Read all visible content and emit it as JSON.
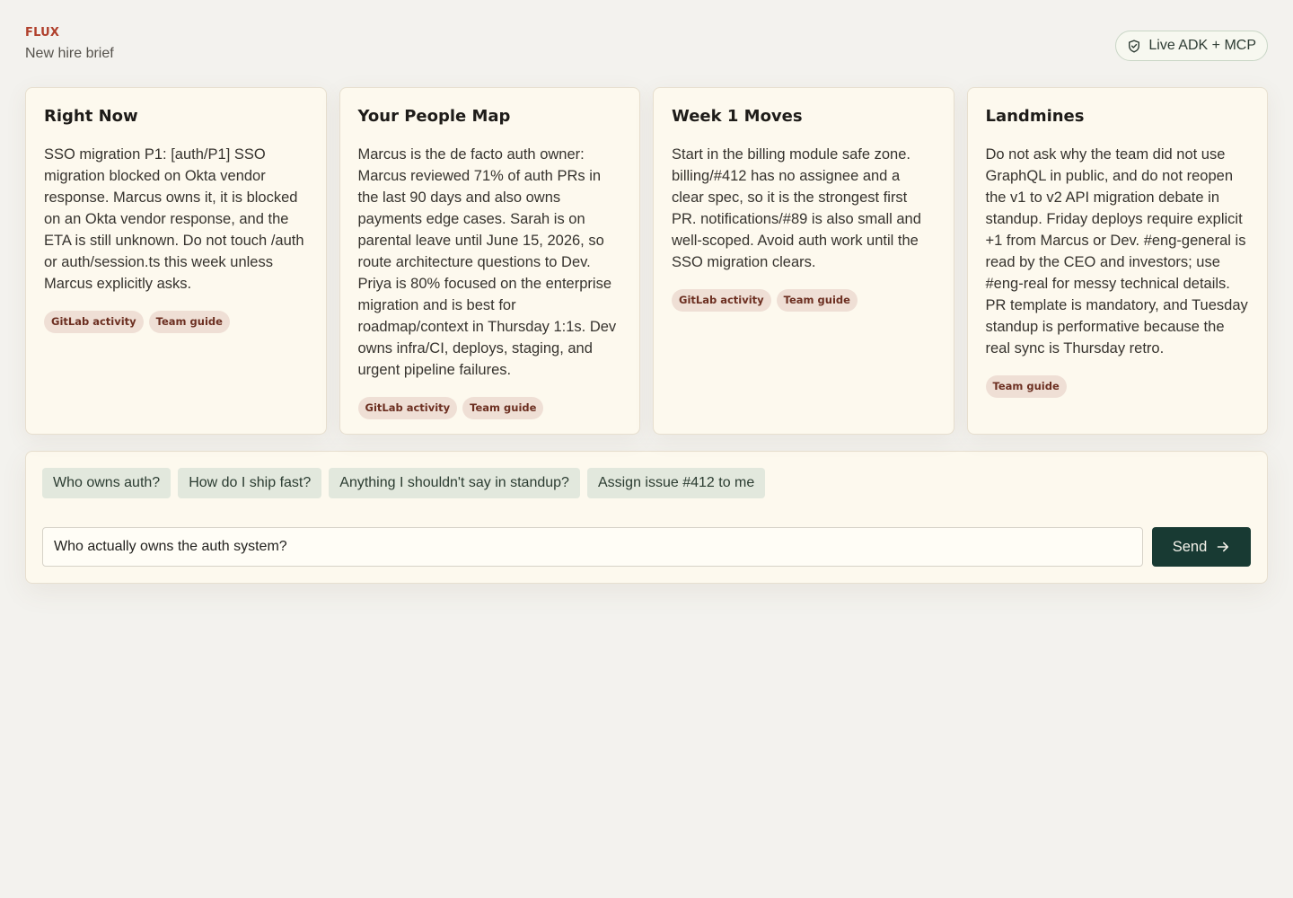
{
  "brand": {
    "logo": "FLUX",
    "subtitle": "New hire brief"
  },
  "live_badge": {
    "icon": "shield-check-icon",
    "label": "Live ADK + MCP"
  },
  "cards": [
    {
      "title": "Right Now",
      "body": "SSO migration P1: [auth/P1] SSO migration blocked on Okta vendor response. Marcus owns it, it is blocked on an Okta vendor response, and the ETA is still unknown. Do not touch /auth or auth/session.ts this week unless Marcus explicitly asks.",
      "tags": [
        "GitLab activity",
        "Team guide"
      ]
    },
    {
      "title": "Your People Map",
      "body": "Marcus is the de facto auth owner: Marcus reviewed 71% of auth PRs in the last 90 days and also owns payments edge cases. Sarah is on parental leave until June 15, 2026, so route architecture questions to Dev. Priya is 80% focused on the enterprise migration and is best for roadmap/context in Thursday 1:1s. Dev owns infra/CI, deploys, staging, and urgent pipeline failures.",
      "tags": [
        "GitLab activity",
        "Team guide"
      ]
    },
    {
      "title": "Week 1 Moves",
      "body": "Start in the billing module safe zone. billing/#412 has no assignee and a clear spec, so it is the strongest first PR. notifications/#89 is also small and well-scoped. Avoid auth work until the SSO migration clears.",
      "tags": [
        "GitLab activity",
        "Team guide"
      ]
    },
    {
      "title": "Landmines",
      "body": "Do not ask why the team did not use GraphQL in public, and do not reopen the v1 to v2 API migration debate in standup. Friday deploys require explicit +1 from Marcus or Dev. #eng-general is read by the CEO and investors; use #eng-real for messy technical details. PR template is mandatory, and Tuesday standup is performative because the real sync is Thursday retro.",
      "tags": [
        "Team guide"
      ]
    }
  ],
  "composer": {
    "suggestions": [
      "Who owns auth?",
      "How do I ship fast?",
      "Anything I shouldn't say in standup?",
      "Assign issue #412 to me"
    ],
    "input_value": "Who actually owns the auth system?",
    "send_label": "Send",
    "send_icon": "arrow-right-icon"
  },
  "colors": {
    "brand": "#b0402c",
    "send_button": "#183a33",
    "chip_bg": "#e2e8dd",
    "tag_bg": "#efdfd5",
    "card_bg": "#fdf9ee",
    "page_bg": "#f3f2ee"
  }
}
